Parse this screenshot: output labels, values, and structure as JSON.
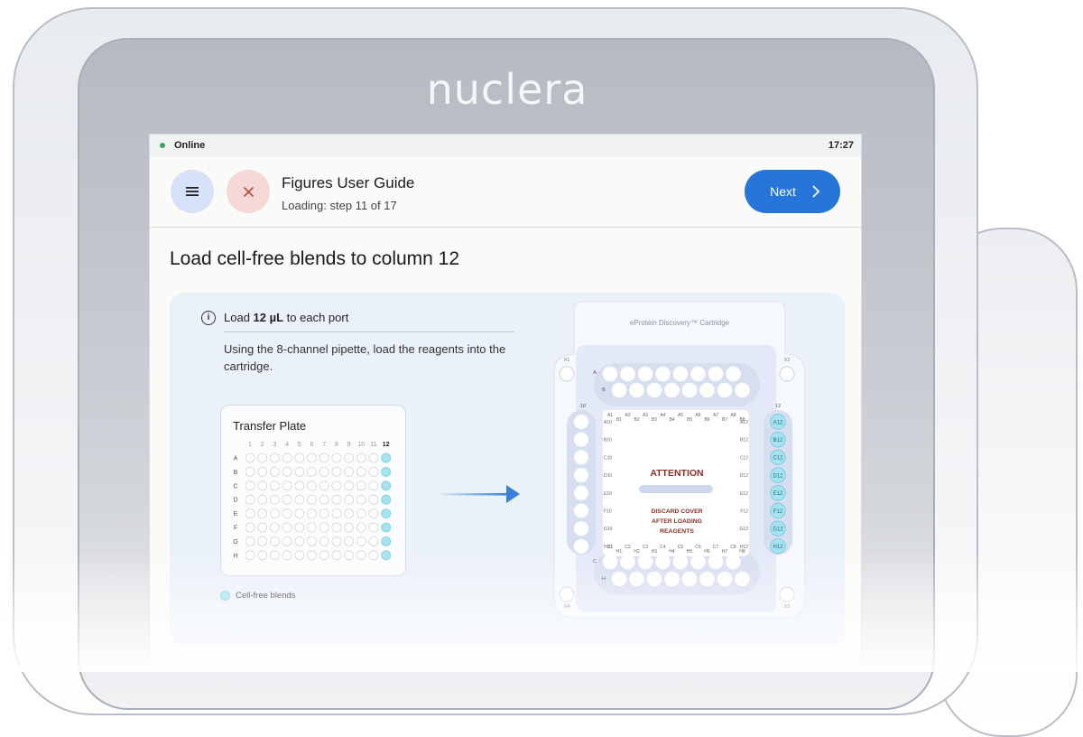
{
  "brand": "nuclera",
  "statusbar": {
    "connection": "Online",
    "time": "17:27"
  },
  "header": {
    "menu_icon": "menu-icon",
    "close_icon": "close-icon",
    "title": "Figures User Guide",
    "subtitle": "Loading: step 11 of 17",
    "next_label": "Next",
    "colors": {
      "accent": "#2576d8",
      "menu_bg": "#d5e2f8",
      "close_bg": "#f4d9d6"
    }
  },
  "step_title": "Load cell-free blends to column 12",
  "instructions": {
    "load_prefix": "Load ",
    "load_amount": "12 µL",
    "load_suffix": " to each port",
    "detail": "Using the 8-channel pipette, load the reagents into the cartridge."
  },
  "transfer_plate": {
    "title": "Transfer Plate",
    "columns": [
      "1",
      "2",
      "3",
      "4",
      "5",
      "6",
      "7",
      "8",
      "9",
      "10",
      "11",
      "12"
    ],
    "rows": [
      "A",
      "B",
      "C",
      "D",
      "E",
      "F",
      "G",
      "H"
    ],
    "highlight_column": "12"
  },
  "legend": {
    "label": "Cell-free blends",
    "color": "#a6e3ef"
  },
  "cartridge": {
    "title": "eProtein Discovery™ Cartridge",
    "corner_labels": [
      "X1",
      "X2",
      "X3",
      "X4"
    ],
    "top_rows": [
      "A",
      "B"
    ],
    "bottom_rows": [
      "C",
      "H"
    ],
    "left_column_label": "10",
    "right_column_label": "12",
    "left_row_labels": [
      "A10",
      "B10",
      "C10",
      "D10",
      "E10",
      "F10",
      "G10",
      "H10"
    ],
    "right_row_labels": [
      "A12",
      "B12",
      "C12",
      "D12",
      "E12",
      "F12",
      "G12",
      "H12"
    ],
    "right_port_labels": [
      "A12",
      "B12",
      "C12",
      "D12",
      "E12",
      "F12",
      "G12",
      "H12"
    ],
    "top_labels_a": [
      "A1",
      "A2",
      "A3",
      "A4",
      "A5",
      "A6",
      "A7",
      "A8"
    ],
    "top_labels_b": [
      "B1",
      "B2",
      "B3",
      "B4",
      "B5",
      "B6",
      "B7",
      "B8"
    ],
    "bottom_labels_c": [
      "C1",
      "C2",
      "C3",
      "C4",
      "C5",
      "C6",
      "C7",
      "C8"
    ],
    "bottom_labels_h": [
      "H1",
      "H2",
      "H3",
      "H4",
      "H5",
      "H6",
      "H7",
      "H8"
    ],
    "attention": "ATTENTION",
    "notice": [
      "DISCARD COVER",
      "AFTER LOADING",
      "REAGENTS"
    ]
  }
}
